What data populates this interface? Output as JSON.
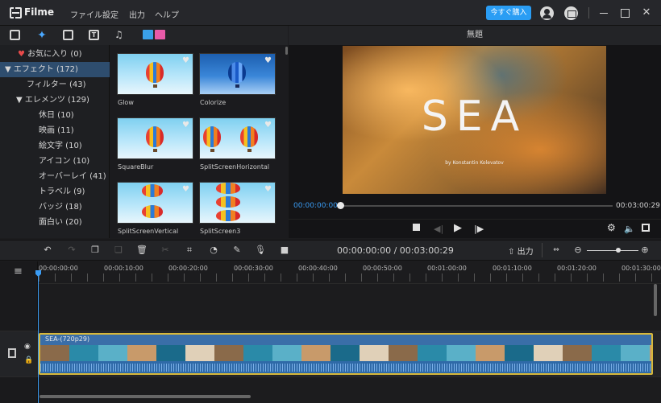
{
  "titlebar": {
    "app_name": "Filme",
    "menu": [
      "ファイル",
      "設定",
      "出力",
      "ヘルプ"
    ],
    "buy_label": "今すぐ購入",
    "icons": [
      "user-icon",
      "mail-icon",
      "minimize-icon",
      "maximize-icon",
      "close-icon"
    ]
  },
  "library": {
    "tabs": [
      "media-icon",
      "effects-icon",
      "transitions-icon",
      "text-icon",
      "music-icon",
      "split-screen-icon"
    ],
    "active_tab": "effects-icon",
    "categories": [
      {
        "label": "お気に入り (0)"
      },
      {
        "label": "エフェクト (172)"
      },
      {
        "label": "フィルター (43)"
      },
      {
        "label": "エレメンツ (129)"
      },
      {
        "label": "休日 (10)"
      },
      {
        "label": "映画 (11)"
      },
      {
        "label": "絵文字 (10)"
      },
      {
        "label": "アイコン (10)"
      },
      {
        "label": "オーバーレイ (41)"
      },
      {
        "label": "トラベル (9)"
      },
      {
        "label": "バッジ (18)"
      },
      {
        "label": "面白い (20)"
      }
    ],
    "selected_category": "エフェクト (172)",
    "effects": [
      {
        "label": "Glow"
      },
      {
        "label": "Colorize"
      },
      {
        "label": "SquareBlur"
      },
      {
        "label": "SplitScreenHorizontal"
      },
      {
        "label": "SplitScreenVertical"
      },
      {
        "label": "SplitScreen3"
      }
    ]
  },
  "preview": {
    "title": "無題",
    "video_text": "SEA",
    "video_credit": "by Konstantin Kolevatov",
    "current_time": "00:00:00:00",
    "total_time": "00:03:00:29",
    "progress": 0
  },
  "edit_toolbar": {
    "timecode": "00:00:00:00 / 00:03:00:29",
    "export_label": "出力"
  },
  "timeline": {
    "ruler": [
      "00:00:00:00",
      "00:00:10:00",
      "00:00:20:00",
      "00:00:30:00",
      "00:00:40:00",
      "00:00:50:00",
      "00:01:00:00",
      "00:01:10:00",
      "00:01:20:00",
      "00:01:30:00"
    ],
    "clip_name": "SEA-(720p29)"
  },
  "colors": {
    "accent": "#2a9df4",
    "selection": "#2e4d6e",
    "clip_border": "#d8b83a",
    "favorite": "#e84a4a"
  }
}
